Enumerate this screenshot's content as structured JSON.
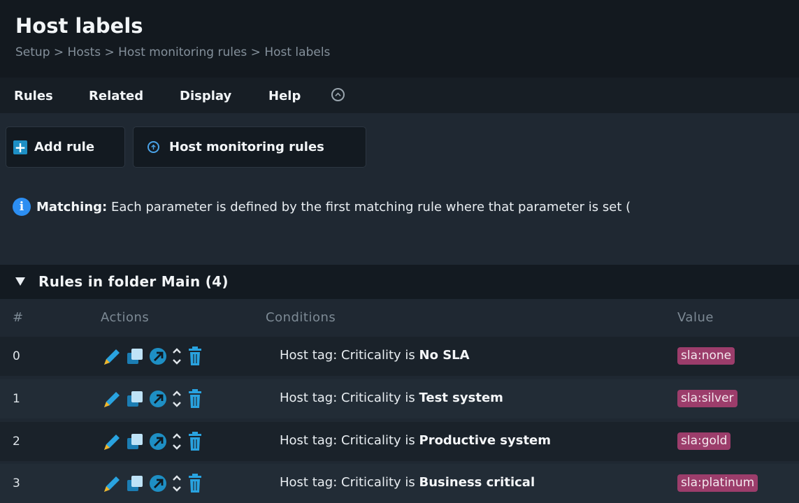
{
  "page": {
    "title": "Host labels",
    "breadcrumb": "Setup > Hosts > Host monitoring rules > Host labels"
  },
  "menu": {
    "items": [
      "Rules",
      "Related",
      "Display",
      "Help"
    ],
    "toggle_icon": "chevron-up-circle-icon"
  },
  "toolbar": {
    "add_rule_label": "Add rule",
    "host_monitoring_rules_label": "Host monitoring rules"
  },
  "info": {
    "label": "Matching:",
    "text": "Each parameter is defined by the first matching rule where that parameter is set (",
    "icon": "info-icon"
  },
  "folder": {
    "title": "Rules in folder Main (4)"
  },
  "table": {
    "headers": [
      "#",
      "Actions",
      "Conditions",
      "Value"
    ],
    "rows": [
      {
        "num": "0",
        "condition_prefix": "Host tag: Criticality is ",
        "condition_value": "No SLA",
        "value": "sla:none"
      },
      {
        "num": "1",
        "condition_prefix": "Host tag: Criticality is ",
        "condition_value": "Test system",
        "value": "sla:silver"
      },
      {
        "num": "2",
        "condition_prefix": "Host tag: Criticality is ",
        "condition_value": "Productive system",
        "value": "sla:gold"
      },
      {
        "num": "3",
        "condition_prefix": "Host tag: Criticality is ",
        "condition_value": "Business critical",
        "value": "sla:platinum"
      }
    ],
    "action_icons": [
      "edit-pencil-icon",
      "clone-icon",
      "export-arrow-icon",
      "move-updown-icon",
      "trash-icon"
    ]
  },
  "colors": {
    "accent": "#1e8fc4",
    "badge": "#9c3d6b",
    "info": "#2c8ef2"
  }
}
